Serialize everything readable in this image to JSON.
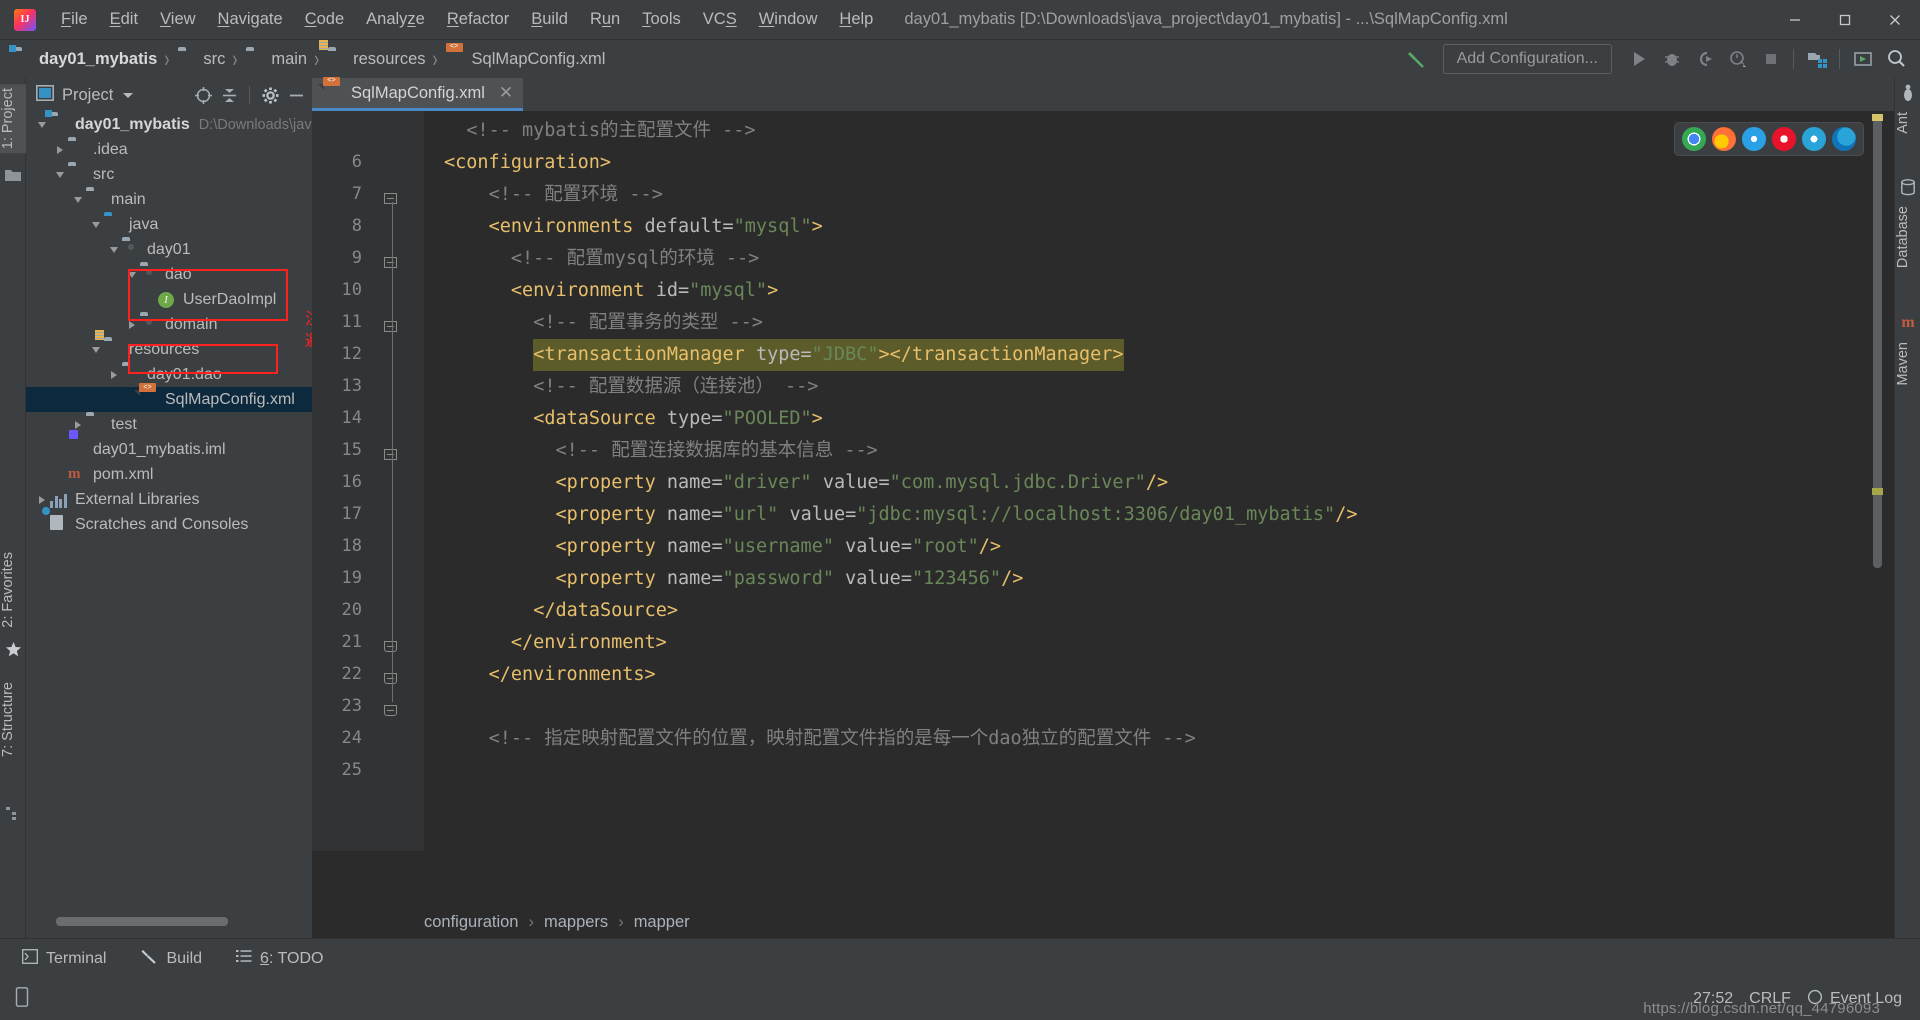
{
  "window": {
    "title": "day01_mybatis [D:\\Downloads\\java_project\\day01_mybatis] - ...\\SqlMapConfig.xml",
    "minimize": "—",
    "maximize": "❐",
    "close": "✕"
  },
  "menu": [
    {
      "label": "File",
      "mnemonic": "F"
    },
    {
      "label": "Edit",
      "mnemonic": "E"
    },
    {
      "label": "View",
      "mnemonic": "V"
    },
    {
      "label": "Navigate",
      "mnemonic": "N"
    },
    {
      "label": "Code",
      "mnemonic": "C"
    },
    {
      "label": "Analyze",
      "mnemonic": "z"
    },
    {
      "label": "Refactor",
      "mnemonic": "R"
    },
    {
      "label": "Build",
      "mnemonic": "B"
    },
    {
      "label": "Run",
      "mnemonic": "u"
    },
    {
      "label": "Tools",
      "mnemonic": "T"
    },
    {
      "label": "VCS",
      "mnemonic": "S"
    },
    {
      "label": "Window",
      "mnemonic": "W"
    },
    {
      "label": "Help",
      "mnemonic": "H"
    }
  ],
  "breadcrumb": [
    {
      "label": "day01_mybatis",
      "icon": "module-folder-icon"
    },
    {
      "label": "src",
      "icon": "folder-icon"
    },
    {
      "label": "main",
      "icon": "folder-icon"
    },
    {
      "label": "resources",
      "icon": "resources-folder-icon"
    },
    {
      "label": "SqlMapConfig.xml",
      "icon": "xml-file-icon"
    }
  ],
  "toolbar": {
    "add_configuration": "Add Configuration...",
    "icons": [
      "run-icon",
      "debug-icon",
      "run-with-coverage-icon",
      "profile-icon",
      "stop-icon",
      "project-structure-icon",
      "update-icon",
      "search-icon"
    ]
  },
  "left_stripe": [
    {
      "label": "1: Project",
      "selected": true
    },
    {
      "label": "2: Favorites",
      "selected": false
    },
    {
      "label": "7: Structure",
      "selected": false
    }
  ],
  "right_stripe": [
    {
      "label": "Ant",
      "selected": false
    },
    {
      "label": "Database",
      "selected": false
    },
    {
      "label": "Maven",
      "selected": false
    }
  ],
  "project_panel": {
    "title": "Project",
    "header_icons": [
      "locate-icon",
      "collapse-all-icon",
      "settings-gear-icon",
      "hide-icon"
    ],
    "tree": [
      {
        "indent": 0,
        "twisty": "down",
        "icon": "module-folder-icon",
        "label": "day01_mybatis",
        "sublabel": "D:\\Downloads\\jav",
        "bold": true,
        "selected": false
      },
      {
        "indent": 1,
        "twisty": "right",
        "icon": "folder-icon",
        "label": ".idea",
        "sublabel": "",
        "bold": false,
        "selected": false
      },
      {
        "indent": 1,
        "twisty": "down",
        "icon": "folder-icon",
        "label": "src",
        "sublabel": "",
        "bold": false,
        "selected": false
      },
      {
        "indent": 2,
        "twisty": "down",
        "icon": "folder-icon",
        "label": "main",
        "sublabel": "",
        "bold": false,
        "selected": false
      },
      {
        "indent": 3,
        "twisty": "down",
        "icon": "source-folder-icon",
        "label": "java",
        "sublabel": "",
        "bold": false,
        "selected": false
      },
      {
        "indent": 4,
        "twisty": "down",
        "icon": "package-icon",
        "label": "day01",
        "sublabel": "",
        "bold": false,
        "selected": false
      },
      {
        "indent": 5,
        "twisty": "down",
        "icon": "package-icon",
        "label": "dao",
        "sublabel": "",
        "bold": false,
        "selected": false
      },
      {
        "indent": 6,
        "twisty": "none",
        "icon": "interface-icon",
        "label": "UserDaoImpl",
        "sublabel": "",
        "bold": false,
        "selected": false
      },
      {
        "indent": 5,
        "twisty": "right",
        "icon": "package-icon",
        "label": "domain",
        "sublabel": "",
        "bold": false,
        "selected": false
      },
      {
        "indent": 3,
        "twisty": "down",
        "icon": "resources-folder-icon",
        "label": "resources",
        "sublabel": "",
        "bold": false,
        "selected": false
      },
      {
        "indent": 4,
        "twisty": "right",
        "icon": "folder-icon",
        "label": "day01.dao",
        "sublabel": "",
        "bold": false,
        "selected": false
      },
      {
        "indent": 5,
        "twisty": "none",
        "icon": "xml-file-icon",
        "label": "SqlMapConfig.xml",
        "sublabel": "",
        "bold": false,
        "selected": true
      },
      {
        "indent": 2,
        "twisty": "right",
        "icon": "folder-icon",
        "label": "test",
        "sublabel": "",
        "bold": false,
        "selected": false
      },
      {
        "indent": 1,
        "twisty": "none",
        "icon": "iml-file-icon",
        "label": "day01_mybatis.iml",
        "sublabel": "",
        "bold": false,
        "selected": false
      },
      {
        "indent": 1,
        "twisty": "none",
        "icon": "maven-file-icon",
        "label": "pom.xml",
        "sublabel": "",
        "bold": false,
        "selected": false
      },
      {
        "indent": 0,
        "twisty": "right",
        "icon": "external-libraries-icon",
        "label": "External Libraries",
        "sublabel": "",
        "bold": false,
        "selected": false
      },
      {
        "indent": 0,
        "twisty": "none",
        "icon": "scratches-icon",
        "label": "Scratches and Consoles",
        "sublabel": "",
        "bold": false,
        "selected": false
      }
    ],
    "annotation": {
      "line1": "注意包名的对应，",
      "line2": "避免后期难以查找",
      "color": "#ff2020"
    }
  },
  "editor": {
    "tab": {
      "label": "SqlMapConfig.xml",
      "icon": "xml-file-icon",
      "close": "✕"
    },
    "first_line": 6,
    "highlight_line": 13,
    "lines": [
      {
        "n": 6,
        "indent": 1,
        "fold": "none",
        "segs": [
          {
            "t": "<!-- mybatis的主配置文件 -->",
            "c": "cm"
          }
        ]
      },
      {
        "n": 7,
        "indent": 0,
        "fold": "open",
        "segs": [
          {
            "t": "<configuration>",
            "c": "tag"
          }
        ]
      },
      {
        "n": 8,
        "indent": 2,
        "fold": "none",
        "segs": [
          {
            "t": "<!-- 配置环境 -->",
            "c": "cm"
          }
        ]
      },
      {
        "n": 9,
        "indent": 2,
        "fold": "open",
        "segs": [
          {
            "t": "<environments ",
            "c": "tag"
          },
          {
            "t": "default=",
            "c": "attr"
          },
          {
            "t": "\"mysql\"",
            "c": "val"
          },
          {
            "t": ">",
            "c": "tag"
          }
        ]
      },
      {
        "n": 10,
        "indent": 3,
        "fold": "none",
        "segs": [
          {
            "t": "<!-- 配置mysql的环境 -->",
            "c": "cm"
          }
        ]
      },
      {
        "n": 11,
        "indent": 3,
        "fold": "open",
        "segs": [
          {
            "t": "<environment ",
            "c": "tag"
          },
          {
            "t": "id=",
            "c": "attr"
          },
          {
            "t": "\"mysql\"",
            "c": "val"
          },
          {
            "t": ">",
            "c": "tag"
          }
        ]
      },
      {
        "n": 12,
        "indent": 4,
        "fold": "none",
        "segs": [
          {
            "t": "<!-- 配置事务的类型 -->",
            "c": "cm"
          }
        ]
      },
      {
        "n": 13,
        "indent": 4,
        "fold": "none",
        "segs": [
          {
            "t": "<transactionManager ",
            "c": "tag"
          },
          {
            "t": "type=",
            "c": "attr"
          },
          {
            "t": "\"JDBC\"",
            "c": "val"
          },
          {
            "t": "></transactionManager>",
            "c": "tag"
          }
        ]
      },
      {
        "n": 14,
        "indent": 4,
        "fold": "none",
        "segs": [
          {
            "t": "<!-- 配置数据源（连接池） -->",
            "c": "cm"
          }
        ]
      },
      {
        "n": 15,
        "indent": 4,
        "fold": "open",
        "segs": [
          {
            "t": "<dataSource ",
            "c": "tag"
          },
          {
            "t": "type=",
            "c": "attr"
          },
          {
            "t": "\"POOLED\"",
            "c": "val"
          },
          {
            "t": ">",
            "c": "tag"
          }
        ]
      },
      {
        "n": 16,
        "indent": 5,
        "fold": "none",
        "segs": [
          {
            "t": "<!-- 配置连接数据库的基本信息 -->",
            "c": "cm"
          }
        ]
      },
      {
        "n": 17,
        "indent": 5,
        "fold": "none",
        "segs": [
          {
            "t": "<property ",
            "c": "tag"
          },
          {
            "t": "name=",
            "c": "attr"
          },
          {
            "t": "\"driver\"",
            "c": "val"
          },
          {
            "t": " ",
            "c": "eq"
          },
          {
            "t": "value=",
            "c": "attr"
          },
          {
            "t": "\"com.mysql.jdbc.Driver\"",
            "c": "val"
          },
          {
            "t": "/>",
            "c": "tag"
          }
        ]
      },
      {
        "n": 18,
        "indent": 5,
        "fold": "none",
        "segs": [
          {
            "t": "<property ",
            "c": "tag"
          },
          {
            "t": "name=",
            "c": "attr"
          },
          {
            "t": "\"url\"",
            "c": "val"
          },
          {
            "t": " ",
            "c": "eq"
          },
          {
            "t": "value=",
            "c": "attr"
          },
          {
            "t": "\"jdbc:mysql://localhost:3306/day01_mybatis\"",
            "c": "val"
          },
          {
            "t": "/>",
            "c": "tag"
          }
        ]
      },
      {
        "n": 19,
        "indent": 5,
        "fold": "none",
        "segs": [
          {
            "t": "<property ",
            "c": "tag"
          },
          {
            "t": "name=",
            "c": "attr"
          },
          {
            "t": "\"username\"",
            "c": "val"
          },
          {
            "t": " ",
            "c": "eq"
          },
          {
            "t": "value=",
            "c": "attr"
          },
          {
            "t": "\"root\"",
            "c": "val"
          },
          {
            "t": "/>",
            "c": "tag"
          }
        ]
      },
      {
        "n": 20,
        "indent": 5,
        "fold": "none",
        "segs": [
          {
            "t": "<property ",
            "c": "tag"
          },
          {
            "t": "name=",
            "c": "attr"
          },
          {
            "t": "\"password\"",
            "c": "val"
          },
          {
            "t": " ",
            "c": "eq"
          },
          {
            "t": "value=",
            "c": "attr"
          },
          {
            "t": "\"123456\"",
            "c": "val"
          },
          {
            "t": "/>",
            "c": "tag"
          }
        ]
      },
      {
        "n": 21,
        "indent": 4,
        "fold": "close",
        "segs": [
          {
            "t": "</dataSource>",
            "c": "tag"
          }
        ]
      },
      {
        "n": 22,
        "indent": 3,
        "fold": "close",
        "segs": [
          {
            "t": "</environment>",
            "c": "tag"
          }
        ]
      },
      {
        "n": 23,
        "indent": 2,
        "fold": "close",
        "segs": [
          {
            "t": "</environments>",
            "c": "tag"
          }
        ]
      },
      {
        "n": 24,
        "indent": 0,
        "fold": "none",
        "segs": []
      },
      {
        "n": 25,
        "indent": 2,
        "fold": "none",
        "segs": [
          {
            "t": "<!-- 指定映射配置文件的位置，映射配置文件指的是每一个dao独立的配置文件 -->",
            "c": "cm"
          }
        ]
      }
    ],
    "browser_popup": [
      "chrome-icon",
      "firefox-icon",
      "safari-icon",
      "opera-icon",
      "explorer-icon",
      "edge-icon"
    ],
    "breadcrumbs": [
      "configuration",
      "mappers",
      "mapper"
    ]
  },
  "bottom_bar": [
    {
      "label": "Terminal",
      "icon": "terminal-icon",
      "mnemonic": ""
    },
    {
      "label": "Build",
      "icon": "build-hammer-icon",
      "mnemonic": ""
    },
    {
      "label": "6: TODO",
      "icon": "todo-list-icon",
      "mnemonic": "6"
    }
  ],
  "status_bar": {
    "position": "27:52",
    "line_separator": "CRLF",
    "event_log": "Event Log",
    "event_log_icon": "balloon-icon"
  },
  "watermark": "https://blog.csdn.net/qq_44796093"
}
